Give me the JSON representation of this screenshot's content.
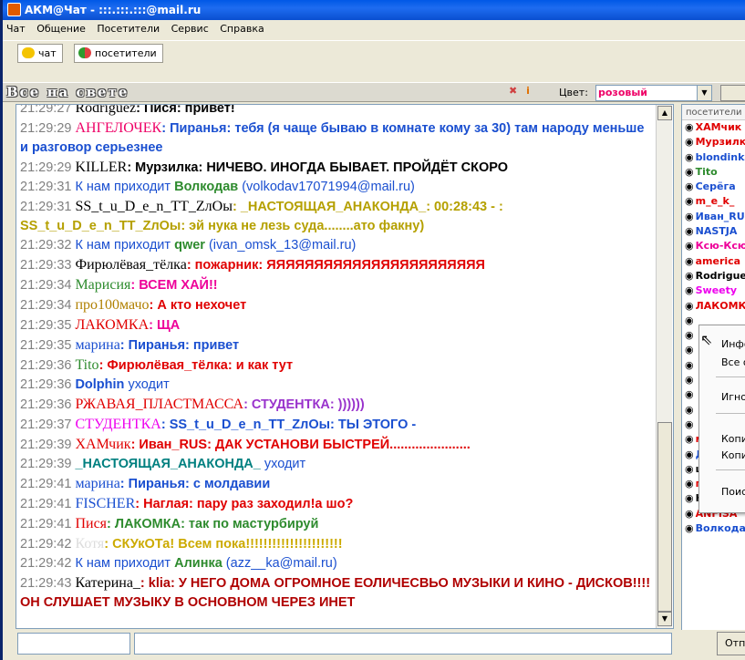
{
  "window": {
    "title": "АКМ@Чат - :::.:::.:::@mail.ru"
  },
  "menu": [
    "Чат",
    "Общение",
    "Посетители",
    "Сервис",
    "Справка"
  ],
  "toolbar": {
    "chat_tab": "чат",
    "visitors_tab": "посетители"
  },
  "room": {
    "name": "Все на свете",
    "color_label": "Цвет:",
    "color_value": "розовый"
  },
  "chat": [
    {
      "time": "21:29:27",
      "nick": "Rodriguez",
      "nick_color": "#000000",
      "text": ": Пися: привет!",
      "text_color": "#000000"
    },
    {
      "time": "21:29:29",
      "nick": "АНГЕЛОЧЕК",
      "nick_color": "#ee0066",
      "text": ": Пиранья: тебя (я чаще бываю в комнате кому за 30) там народу меньше и разговор серьезнее",
      "text_color": "#1a4fd0",
      "wrap": true
    },
    {
      "time": "21:29:29",
      "nick": "KILLER",
      "nick_color": "#000000",
      "text": ": Мурзилка: НИЧЕВО. ИНОГДА БЫВАЕТ. ПРОЙДЁТ СКОРО",
      "text_color": "#000000"
    },
    {
      "time": "21:29:31",
      "nick": "",
      "nick_color": "#000000",
      "text": "",
      "text_color": "#000000",
      "system": "К нам приходит",
      "sys_nick": "Волкодав",
      "sys_extra": " (volkodav17071994@mail.ru)"
    },
    {
      "time": "21:29:31",
      "nick": "SS_t_u_D_e_n_TT_ZлOы",
      "nick_color": "#000000",
      "text": ": _НАСТОЯЩАЯ_АНАКОНДА_: 00:28:43 - : SS_t_u_D_e_n_TT_ZлOы: эй нука не лезь суда........ато факну)",
      "text_color": "#b5a000",
      "wrap": true
    },
    {
      "time": "21:29:32",
      "nick": "",
      "nick_color": "#000000",
      "text": "",
      "text_color": "#000000",
      "system": "К нам приходит",
      "sys_nick": "qwer",
      "sys_extra": " (ivan_omsk_13@mail.ru)"
    },
    {
      "time": "21:29:33",
      "nick": "Фирюлёвая_тёлка",
      "nick_color": "#000000",
      "text": ": пожарник: ЯЯЯЯЯЯЯЯЯЯЯЯЯЯЯЯЯЯЯЯЯЯЯ",
      "text_color": "#e00000"
    },
    {
      "time": "21:29:34",
      "nick": "Марисия",
      "nick_color": "#2e8b2e",
      "text": ": ВСЕМ ХАЙ!!",
      "text_color": "#ee0099"
    },
    {
      "time": "21:29:34",
      "nick": "про100мачо",
      "nick_color": "#b08000",
      "text": ": А кто нехочет",
      "text_color": "#e00000"
    },
    {
      "time": "21:29:35",
      "nick": "ЛАКОМКА",
      "nick_color": "#e00000",
      "text": ": ЩА",
      "text_color": "#ee0099"
    },
    {
      "time": "21:29:35",
      "nick": "марина",
      "nick_color": "#1a4fd0",
      "text": ": Пиранья: привет",
      "text_color": "#1a4fd0"
    },
    {
      "time": "21:29:36",
      "nick": "Tito",
      "nick_color": "#2e8b2e",
      "text": ": Фирюлёвая_тёлка: и как тут",
      "text_color": "#e00000"
    },
    {
      "time": "21:29:36",
      "nick": "",
      "nick_color": "#000000",
      "text": "",
      "text_color": "#000000",
      "system": "",
      "sys_nick": "Dolphin",
      "sys_extra": " уходит",
      "sys_nick_color": "#1a4fd0"
    },
    {
      "time": "21:29:36",
      "nick": "РЖАВАЯ_ПЛАСТМАССА",
      "nick_color": "#e00000",
      "text": ": СТУДЕНТКА: ))))))",
      "text_color": "#9933cc"
    },
    {
      "time": "21:29:37",
      "nick": "СТУДЕНТКА",
      "nick_color": "#ee00ee",
      "text": ": SS_t_u_D_e_n_TT_ZлOы: ТЫ ЭТОГО -",
      "text_color": "#1a4fd0"
    },
    {
      "time": "21:29:39",
      "nick": "ХАМчик",
      "nick_color": "#e00000",
      "text": ": Иван_RUS: ДАК УСТАНОВИ БЫСТРЕЙ......................",
      "text_color": "#e00000"
    },
    {
      "time": "21:29:39",
      "nick": "",
      "nick_color": "#000000",
      "text": "",
      "text_color": "#000000",
      "system": "",
      "sys_nick": "_НАСТОЯЩАЯ_АНАКОНДА_",
      "sys_extra": " уходит",
      "sys_nick_color": "#008080"
    },
    {
      "time": "21:29:41",
      "nick": "марина",
      "nick_color": "#1a4fd0",
      "text": ": Пиранья: с молдавии",
      "text_color": "#1a4fd0"
    },
    {
      "time": "21:29:41",
      "nick": "FISCHER",
      "nick_color": "#1a4fd0",
      "text": ": Наглая: пару раз заходил!а шо?",
      "text_color": "#e00000"
    },
    {
      "time": "21:29:41",
      "nick": "Пися",
      "nick_color": "#e00000",
      "text": ": ЛАКОМКА: так по мастурбируй",
      "text_color": "#2e8b2e"
    },
    {
      "time": "21:29:42",
      "nick": "Котя",
      "nick_color": "#dddddd",
      "text": ": СКУкОТа! Всем пока!!!!!!!!!!!!!!!!!!!!!!",
      "text_color": "#ccaa00"
    },
    {
      "time": "21:29:42",
      "nick": "",
      "nick_color": "#000000",
      "text": "",
      "text_color": "#000000",
      "system": "К нам приходит",
      "sys_nick": "Алинка",
      "sys_extra": " (azz__ka@mail.ru)",
      "sys_nick_color": "#2e8b2e"
    },
    {
      "time": "21:29:43",
      "nick": "Катерина_",
      "nick_color": "#000000",
      "text": ": klia: У НЕГО ДОМА ОГРОМНОЕ ЕОЛИЧЕСВЬО МУЗЫКИ И КИНО - ДИСКОВ!!!! ОН СЛУШАЕТ МУЗЫКУ В ОСНОВНОМ ЧЕРЕЗ ИНЕТ",
      "text_color": "#b00000",
      "wrap": true
    }
  ],
  "users_header": "посетители",
  "users": [
    {
      "name": "ХАМчик",
      "color": "#e00000"
    },
    {
      "name": "Мурзилка",
      "color": "#e00000"
    },
    {
      "name": "blondinka",
      "color": "#1a4fd0"
    },
    {
      "name": "Tito",
      "color": "#2e8b2e"
    },
    {
      "name": "Серёга",
      "color": "#1a4fd0"
    },
    {
      "name": "m_e_k_",
      "color": "#e00000"
    },
    {
      "name": "Иван_RUS",
      "color": "#1a4fd0"
    },
    {
      "name": "NASTJA",
      "color": "#1a4fd0"
    },
    {
      "name": "Ксю-Ксю",
      "color": "#ee0099"
    },
    {
      "name": "america",
      "color": "#e00000"
    },
    {
      "name": "Rodriguez",
      "color": "#000000"
    },
    {
      "name": "Sweety",
      "color": "#ee00ee"
    },
    {
      "name": "ЛАКОМКА",
      "color": "#e00000"
    },
    {
      "name": "",
      "color": "#000000"
    },
    {
      "name": "",
      "color": "#000000"
    },
    {
      "name": "",
      "color": "#000000"
    },
    {
      "name": "",
      "color": "#000000"
    },
    {
      "name": "",
      "color": "#000000"
    },
    {
      "name": "",
      "color": "#000000"
    },
    {
      "name": "",
      "color": "#000000"
    },
    {
      "name": "",
      "color": "#000000"
    },
    {
      "name": "мулатка",
      "color": "#e00000"
    },
    {
      "name": "Дед_мороз",
      "color": "#1a4fd0"
    },
    {
      "name": "шелест",
      "color": "#000000"
    },
    {
      "name": "пламя_",
      "color": "#e00000"
    },
    {
      "name": "Нежный",
      "color": "#000000"
    },
    {
      "name": "ANFISA",
      "color": "#e00000"
    },
    {
      "name": "Волкодав",
      "color": "#1a4fd0"
    }
  ],
  "context_menu": [
    "Инфо",
    "Все о",
    "Игно",
    "Копи",
    "Копи",
    "Поис"
  ],
  "send_label": "Отп"
}
